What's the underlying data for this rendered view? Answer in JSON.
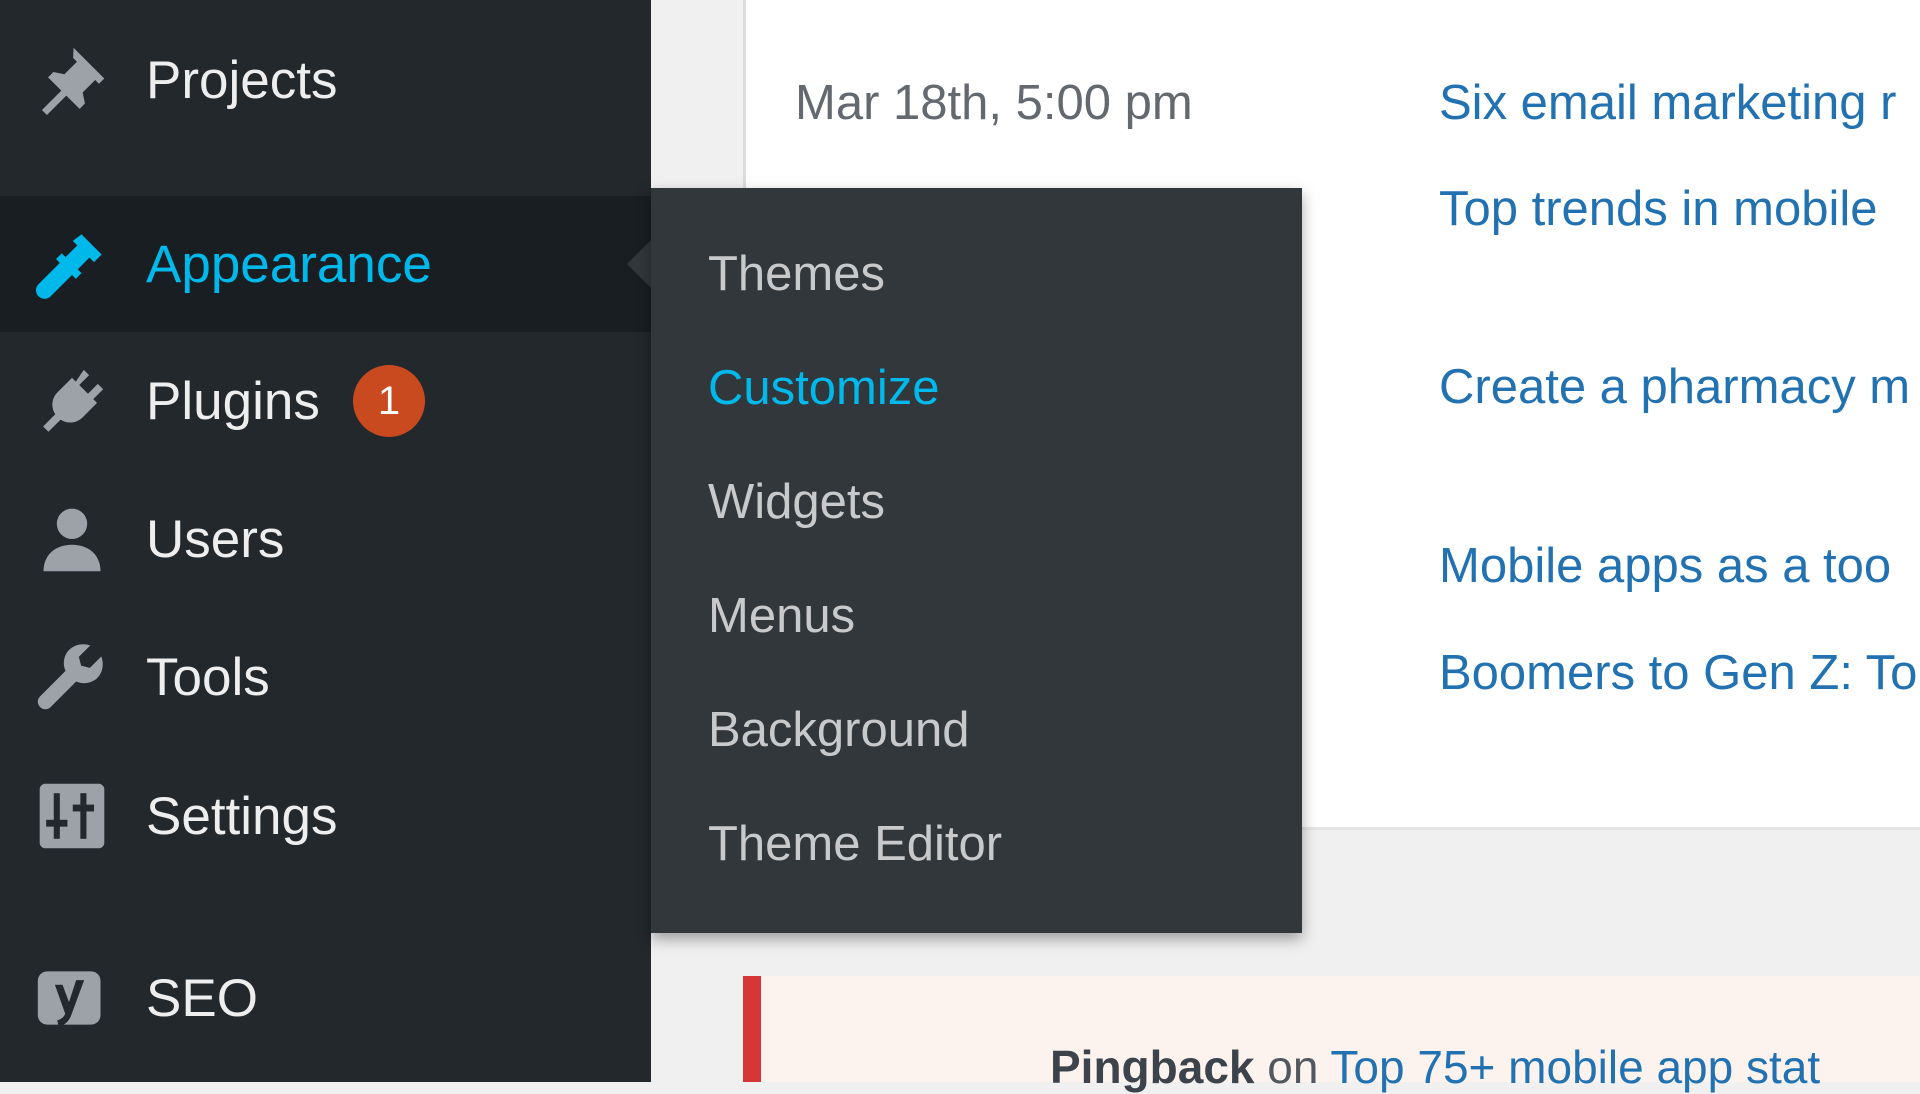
{
  "sidebar": {
    "items": [
      {
        "label": "Projects",
        "icon": "pin-icon"
      },
      {
        "label": "Appearance",
        "icon": "paintbrush-icon"
      },
      {
        "label": "Plugins",
        "icon": "plug-icon",
        "badge": "1"
      },
      {
        "label": "Users",
        "icon": "user-icon"
      },
      {
        "label": "Tools",
        "icon": "wrench-icon"
      },
      {
        "label": "Settings",
        "icon": "sliders-icon"
      },
      {
        "label": "SEO",
        "icon": "yoast-icon"
      }
    ],
    "active": "Appearance"
  },
  "submenu": {
    "items": [
      "Themes",
      "Customize",
      "Widgets",
      "Menus",
      "Background",
      "Theme Editor"
    ],
    "active": "Customize"
  },
  "main": {
    "date": "Mar 18th, 5:00 pm",
    "posts": [
      "Six email marketing r",
      "Top trends in mobile",
      "Create a pharmacy m",
      "Mobile apps as a too",
      "Boomers to Gen Z: To"
    ],
    "comment": {
      "type": "Pingback",
      "on": "on",
      "link": "Top 75+ mobile app stat"
    }
  },
  "colors": {
    "sidebar_bg": "#23282d",
    "active_bg": "#191e23",
    "submenu_bg": "#32373c",
    "accent": "#00b9eb",
    "link": "#2271b1",
    "badge": "#ca4a1f",
    "comment_border": "#d63638"
  }
}
